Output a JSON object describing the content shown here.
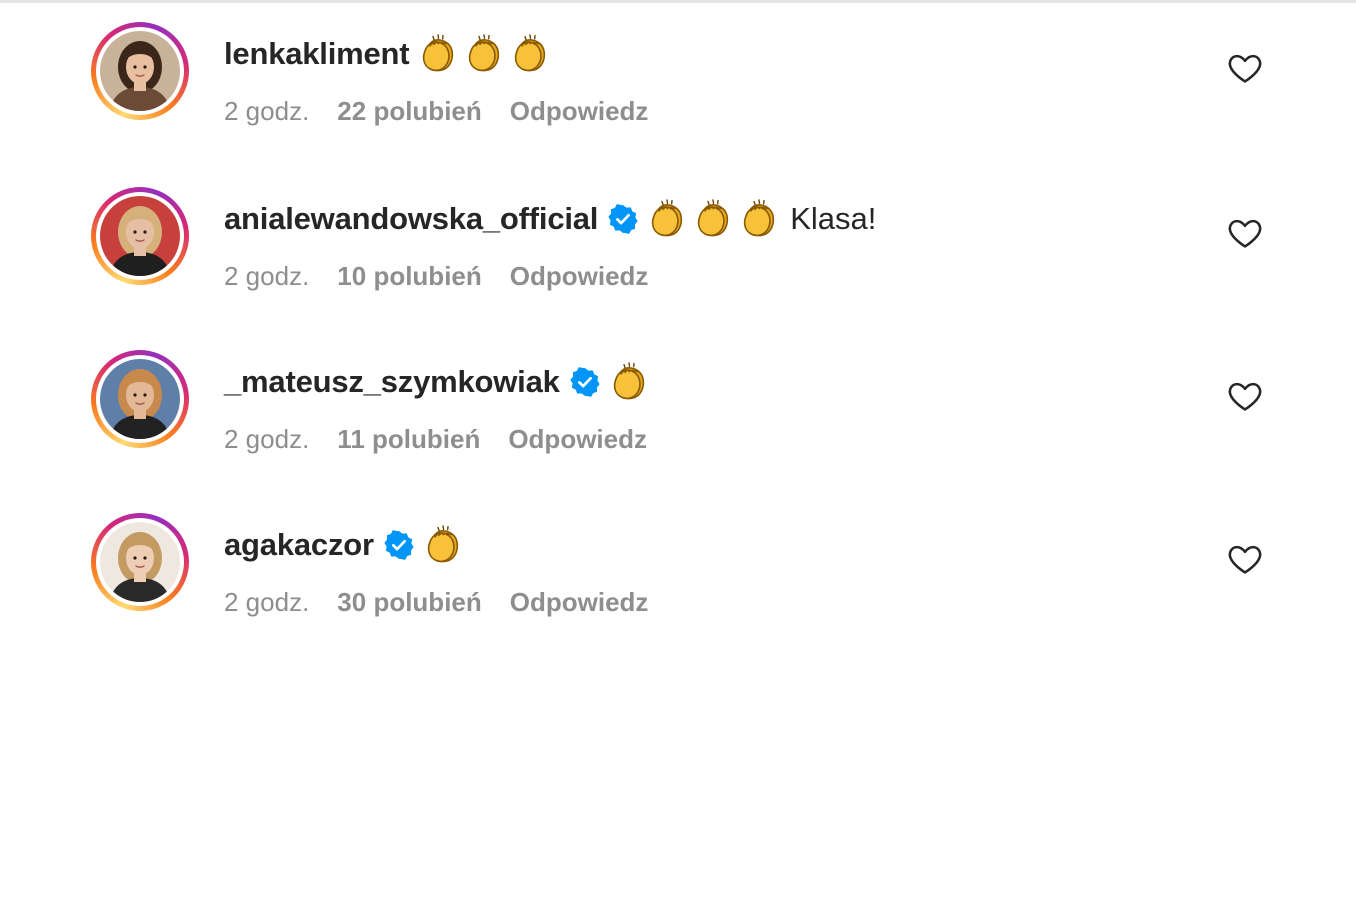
{
  "comments": [
    {
      "username": "lenkakliment",
      "verified": false,
      "claps": 3,
      "text": "",
      "time": "2 godz.",
      "likes": "22 polubień",
      "reply": "Odpowiedz",
      "avatar_palette": {
        "bg": "#c9b29a",
        "hair": "#3b261a",
        "skin": "#e8bfa0",
        "top": "#6b4a36"
      }
    },
    {
      "username": "anialewandowska_official",
      "verified": true,
      "claps": 3,
      "text": "Klasa!",
      "time": "2 godz.",
      "likes": "10 polubień",
      "reply": "Odpowiedz",
      "avatar_palette": {
        "bg": "#c7403c",
        "hair": "#d6b07a",
        "skin": "#e4bfa3",
        "top": "#1f1f1f"
      }
    },
    {
      "username": "_mateusz_szymkowiak",
      "verified": true,
      "claps": 1,
      "text": "",
      "time": "2 godz.",
      "likes": "11 polubień",
      "reply": "Odpowiedz",
      "avatar_palette": {
        "bg": "#5d7fa8",
        "hair": "#c78a4c",
        "skin": "#e3b896",
        "top": "#222222"
      }
    },
    {
      "username": "agakaczor",
      "verified": true,
      "claps": 1,
      "text": "",
      "time": "2 godz.",
      "likes": "30 polubień",
      "reply": "Odpowiedz",
      "avatar_palette": {
        "bg": "#efe8e0",
        "hair": "#c39a62",
        "skin": "#edcdb3",
        "top": "#2a2a2a"
      }
    }
  ],
  "icons": {
    "verified": "verified-badge-icon",
    "clap": "clapping-hands-emoji",
    "like": "heart-outline-icon"
  },
  "colors": {
    "username": "#262626",
    "meta": "#8e8e8e",
    "verified": "#0095f6",
    "clap_fill": "#f7c23a",
    "clap_outline": "#8a5a00",
    "ring_start": "#feda75",
    "ring_end": "#962fbf"
  }
}
